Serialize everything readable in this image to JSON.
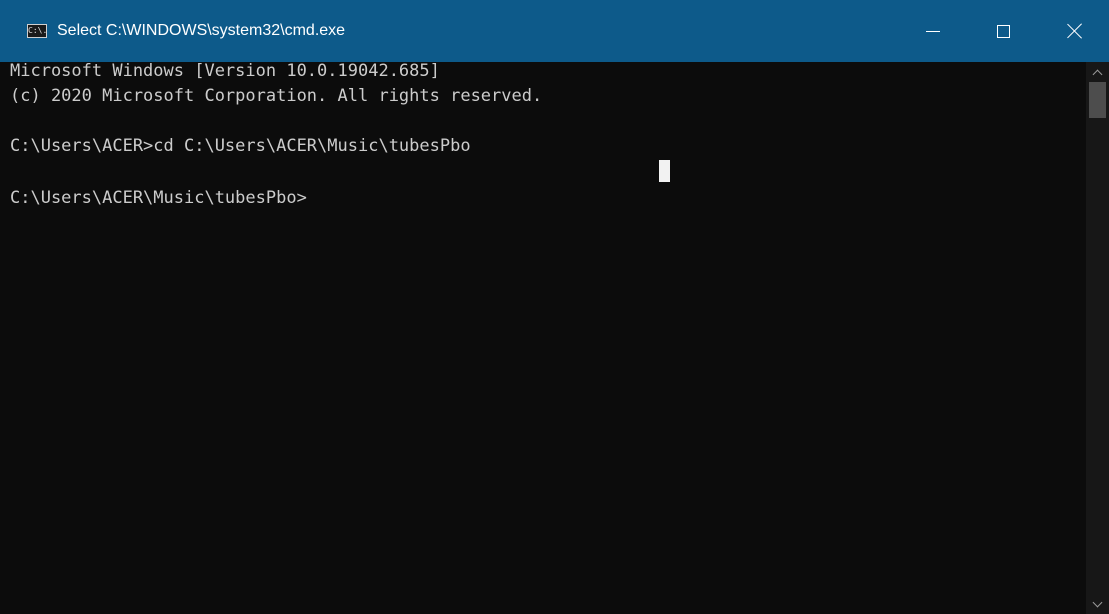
{
  "window": {
    "title": "Select C:\\WINDOWS\\system32\\cmd.exe",
    "icon": "cmd-console-icon",
    "icon_label": "C:\\.",
    "titlebar_color": "#0d5a8a",
    "controls": {
      "minimize": "minimize-icon",
      "maximize": "maximize-icon",
      "close": "close-icon"
    }
  },
  "console": {
    "background": "#0c0c0c",
    "foreground": "#cccccc",
    "lines": [
      "Microsoft Windows [Version 10.0.19042.685]",
      "(c) 2020 Microsoft Corporation. All rights reserved.",
      "C:\\Users\\ACER>cd C:\\Users\\ACER\\Music\\tubesPbo",
      "C:\\Users\\ACER\\Music\\tubesPbo>"
    ]
  }
}
